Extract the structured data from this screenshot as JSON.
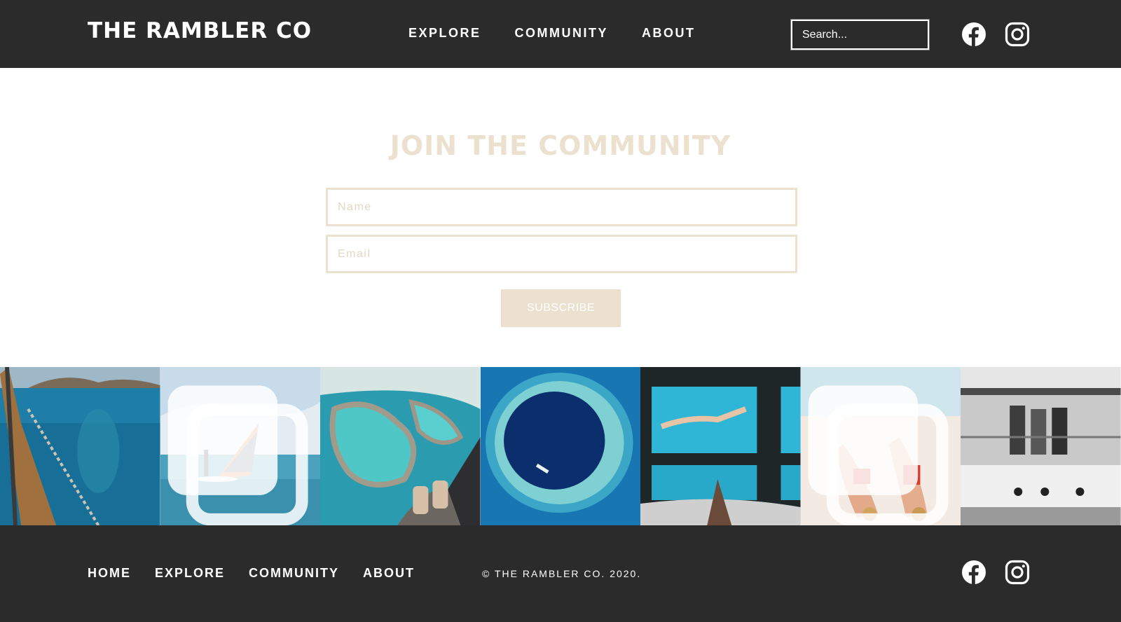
{
  "header": {
    "logo": "THE RAMBLER CO",
    "nav": [
      "EXPLORE",
      "COMMUNITY",
      "ABOUT"
    ],
    "search_placeholder": "Search..."
  },
  "social": {
    "icons": [
      "facebook-icon",
      "instagram-icon"
    ],
    "color": "#ffffff"
  },
  "join": {
    "title": "JOIN THE COMMUNITY",
    "name_placeholder": "Name",
    "email_placeholder": "Email",
    "subscribe_label": "SUBSCRIBE"
  },
  "gallery": {
    "tiles": [
      {
        "subject": "boat bow over turquoise water",
        "multi": false
      },
      {
        "subject": "windsurfer on calm sea",
        "multi": true
      },
      {
        "subject": "aerial reef from helicopter",
        "multi": false
      },
      {
        "subject": "blue hole aerial",
        "multi": false
      },
      {
        "subject": "underwater window with diver",
        "multi": false
      },
      {
        "subject": "two women lying on sand",
        "multi": true
      },
      {
        "subject": "vintage black and white boat",
        "multi": false
      }
    ]
  },
  "footer": {
    "nav": [
      "HOME",
      "EXPLORE",
      "COMMUNITY",
      "ABOUT"
    ],
    "copyright": "© THE RAMBLER CO. 2020."
  },
  "colors": {
    "dark": "#2b2b2b",
    "accent": "#ece1cf",
    "white": "#ffffff"
  }
}
